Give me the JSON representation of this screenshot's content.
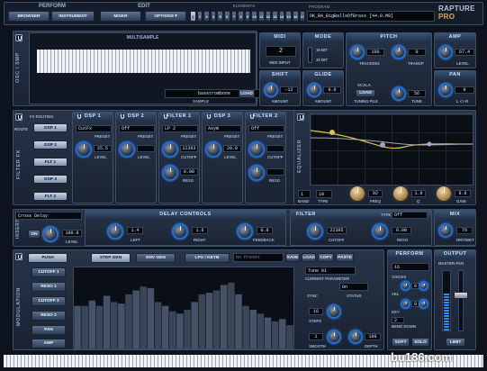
{
  "top": {
    "perform": "PERFORM",
    "browser": "BROWSER",
    "instrument": "INSTRUMENT",
    "edit": "EDIT",
    "mixer": "MIXER",
    "options": "OPTIONS ▾",
    "elements": "ELEMENTS",
    "element_buttons": [
      "1",
      "2",
      "3",
      "4",
      "5",
      "6",
      "7",
      "8",
      "9",
      "10",
      "11",
      "12",
      "13",
      "14",
      "15",
      "16",
      "17"
    ],
    "program": "PROGRAM",
    "program_value": "DK_BA_BigBallsOfBrass [44.0.M8]",
    "logo": "RAPTURE",
    "logo_pro": "PRO"
  },
  "osc": {
    "title": "OSC / SMP",
    "multisample": "MULTISAMPLE",
    "sample_name": "basstrombone",
    "load": "LOAD",
    "sample": "SAMPLE"
  },
  "midi": {
    "title": "MIDI",
    "value": "2",
    "sub": "MIDI INPUT"
  },
  "mode": {
    "title": "MODE",
    "a": "16 BIT",
    "b": "32 BIT"
  },
  "pitch": {
    "title": "PITCH",
    "tracking": "TRACKING",
    "tracking_val": "100",
    "transp": "TRANSP",
    "transp_val": "0"
  },
  "amp": {
    "title": "AMP",
    "level_val": "67.4",
    "level": "LEVEL"
  },
  "shift": {
    "title": "SHIFT",
    "value": "-12",
    "amount": "AMOUNT"
  },
  "glide": {
    "title": "GLIDE",
    "value": "0.0",
    "amount": "AMOUNT"
  },
  "scala": {
    "label": "SCALA",
    "load": "LOAD",
    "tuning": "TUNING FILE",
    "tune_val": "56",
    "tune": "TUNE"
  },
  "pan": {
    "title": "PAN",
    "value": "0",
    "sub": "L <> R"
  },
  "filterfx": {
    "title": "FILTER FX",
    "routing": "FX ROUTING",
    "route": "ROUTE",
    "dsp1": "DSP 1",
    "dsp2": "DSP 2",
    "flt1": "FLT 1",
    "dsp3": "DSP 3",
    "flt2": "FLT 2"
  },
  "dsp1": {
    "title": "DSP 1",
    "preset": "CutFx",
    "preset_lbl": "PRESET",
    "level_val": "25.5",
    "level": "LEVEL",
    "val2": "24.0"
  },
  "dsp2": {
    "title": "DSP 2",
    "preset": "Off",
    "preset_lbl": "PRESET",
    "level": "LEVEL"
  },
  "filter1": {
    "title": "FILTER 1",
    "preset": "LP 2",
    "preset_lbl": "PRESET",
    "cutoff_val": "22393",
    "cutoff": "CUTOFF",
    "reso_val": "0.00",
    "reso": "RESO"
  },
  "dsp3": {
    "title": "DSP 3",
    "preset": "Asym",
    "preset_lbl": "PRESET",
    "level_val": "20.0",
    "level": "LEVEL"
  },
  "filter2": {
    "title": "FILTER 2",
    "preset": "Off",
    "preset_lbl": "PRESET",
    "cutoff": "CUTOFF",
    "reso": "RESO"
  },
  "eq": {
    "title": "EQUALIZER",
    "band_val": "1",
    "band": "BAND",
    "type_val": "10",
    "type": "TYPE",
    "freq_val": "92",
    "freq": "FREQ",
    "q_val": "1.0",
    "q": "Q",
    "gain_val": "9.8",
    "gain": "GAIN"
  },
  "insert": {
    "title": "INSERT",
    "preset": "Cross Delay",
    "on": "ON",
    "level_val": "100.0",
    "level": "LEVEL"
  },
  "delay": {
    "title": "DELAY CONTROLS",
    "left_val": "1.4",
    "left": "LEFT",
    "right_val": "1.6",
    "right": "RIGHT",
    "feedback_val": "0.0",
    "feedback": "FEEDBACK"
  },
  "ifilter": {
    "title": "FILTER",
    "type": "TYPE",
    "type_val": "Off",
    "cutoff_val": "22395",
    "cutoff": "CUTOFF",
    "reso_val": "0.00",
    "reso": "RESO"
  },
  "mix": {
    "title": "MIX",
    "value": "79",
    "sub": "DRY/WET"
  },
  "mod": {
    "title": "MODULATION",
    "push": "PUSH",
    "cutoff1": "CUTOFF 1",
    "reso1": "RESO 1",
    "cutoff2": "CUTOFF 2",
    "reso2": "RESO 2",
    "pan": "PAN",
    "amp": "AMP",
    "stepgen": "STEP GEN",
    "envgen": "ENV GEN",
    "lfo": "LFO / KEYB",
    "preset": "No Preset",
    "save": "SAVE",
    "load": "LOAD",
    "copy": "COPY",
    "paste": "PASTE",
    "tune": "Tune 01",
    "current": "CURRENT PARAMETER",
    "on": "On",
    "sync": "SYNC",
    "status": "STATUS",
    "steps": "STEPS",
    "steps_val": "16",
    "smooth": "SMOOTH",
    "smooth_val": "1",
    "depth": "DEPTH",
    "depth_val": "100"
  },
  "perform": {
    "title": "PERFORM",
    "value": "16",
    "voices": "VOICES",
    "vel": "VEL",
    "lo": "LO",
    "hi": "HI",
    "key": "KEY",
    "out": "OUT",
    "vel_lo": "0",
    "vel_hi": "127",
    "key_lo": "0",
    "key_hi": "127",
    "bend": "BEND DOWN",
    "bend_val": "UP",
    "bend_num": "2",
    "soft": "SOFT",
    "solo": "SOLO"
  },
  "output": {
    "title": "OUTPUT",
    "master": "MASTER PAN",
    "limit": "LIMIT"
  },
  "watermark": "bu186.com",
  "steps": [
    0.55,
    0.55,
    0.62,
    0.55,
    0.68,
    0.6,
    0.58,
    0.7,
    0.75,
    0.8,
    0.78,
    0.6,
    0.55,
    0.48,
    0.45,
    0.5,
    0.6,
    0.7,
    0.72,
    0.75,
    0.82,
    0.85,
    0.7,
    0.55,
    0.5,
    0.45,
    0.4,
    0.35,
    0.38,
    0.3
  ]
}
